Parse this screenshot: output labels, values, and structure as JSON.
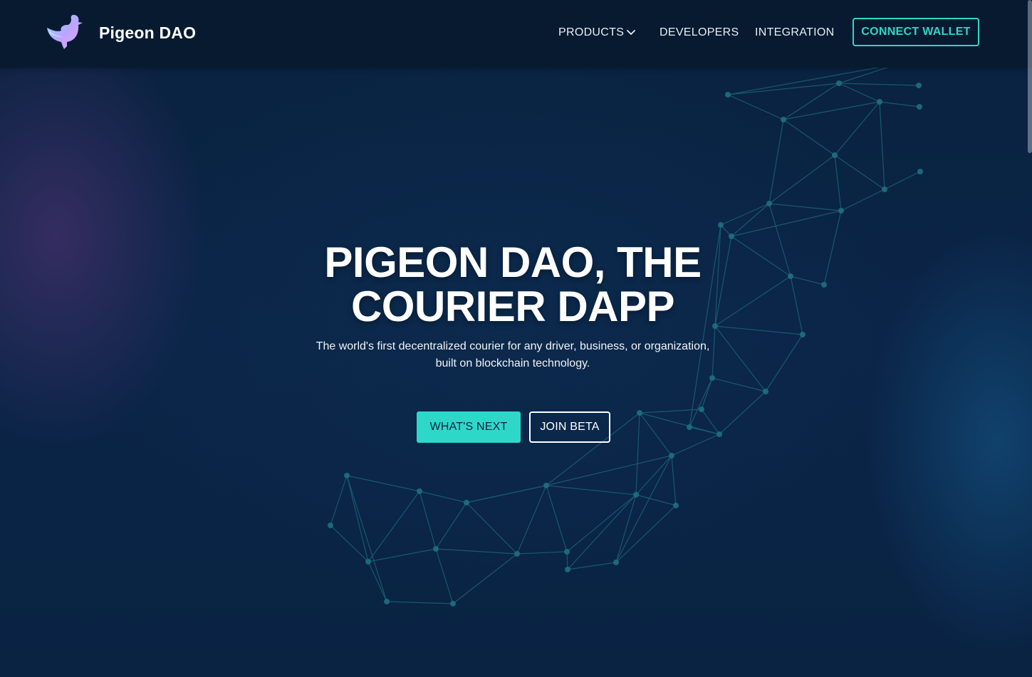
{
  "navbar": {
    "brand": "Pigeon DAO",
    "logo_icon": "pigeon-logo-icon",
    "items": [
      {
        "label": "PRODUCTS",
        "has_dropdown": true,
        "dropdown_icon": "chevron-down-icon"
      },
      {
        "label": "DEVELOPERS"
      },
      {
        "label": "INTEGRATION"
      }
    ],
    "connect_label": "CONNECT WALLET"
  },
  "hero": {
    "title_line1": "PIGEON DAO, THE",
    "title_line2": "COURIER DAPP",
    "subtitle_line1": "The world's first decentralized courier for any driver, business, or organization,",
    "subtitle_line2": "built on blockchain technology.",
    "primary_button": "WHAT'S NEXT",
    "secondary_button": "JOIN BETA"
  },
  "colors": {
    "accent": "#2fd6c7",
    "navbar_bg": "#071a30",
    "page_bg": "#0b2444",
    "network_lines": "#1f6a7c"
  }
}
